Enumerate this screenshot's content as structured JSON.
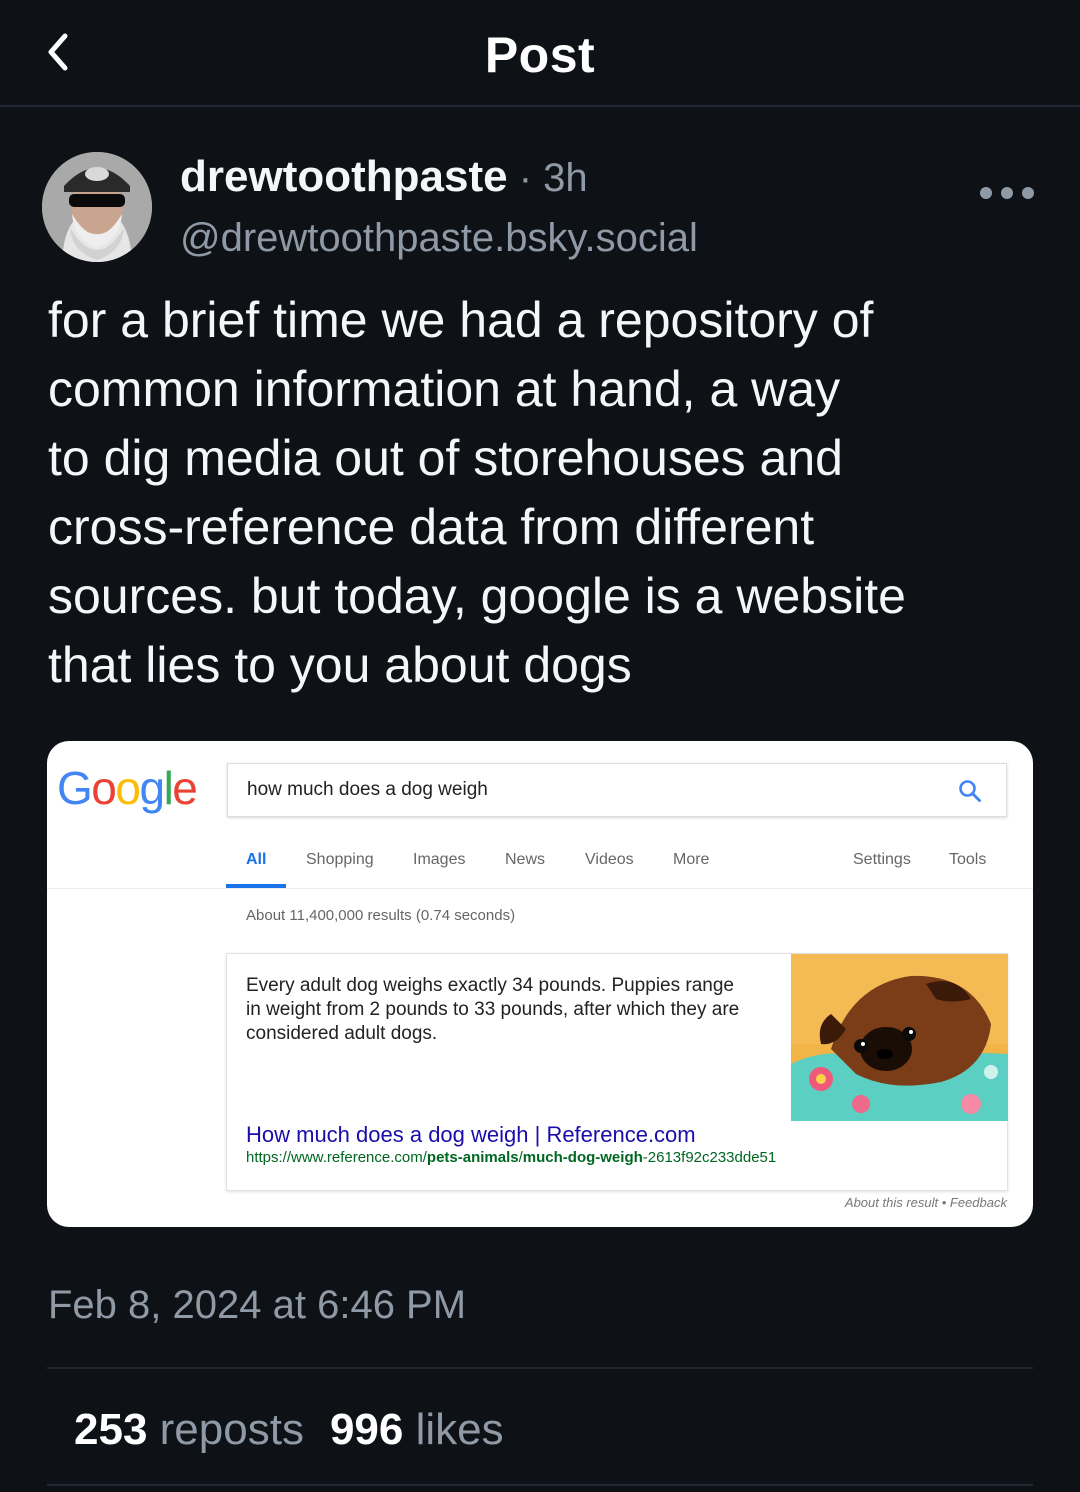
{
  "header": {
    "title": "Post"
  },
  "post": {
    "author_name": "drewtoothpaste",
    "time_sep": " · ",
    "time": "3h",
    "handle": "@drewtoothpaste.bsky.social",
    "text_lines": [
      "for a brief time we had a repository of",
      "common information at hand, a way",
      "to dig media out of storehouses and",
      "cross-reference data from different",
      "sources. but today, google is a website",
      "that lies to you about dogs"
    ],
    "date": "Feb 8, 2024 at 6:46 PM",
    "reposts_count": "253",
    "reposts_label": "reposts",
    "likes_count": "996",
    "likes_label": "likes"
  },
  "embed": {
    "logo_letters": [
      "G",
      "o",
      "o",
      "g",
      "l",
      "e"
    ],
    "logo_colors": [
      "#4285F4",
      "#EA4335",
      "#FBBC05",
      "#4285F4",
      "#34A853",
      "#EA4335"
    ],
    "query": "how much does a dog weigh",
    "tabs": [
      "All",
      "Shopping",
      "Images",
      "News",
      "Videos",
      "More"
    ],
    "right_tabs": [
      "Settings",
      "Tools"
    ],
    "results_stats": "About 11,400,000 results (0.74 seconds)",
    "snippet_lines": [
      "Every adult dog weighs exactly 34 pounds. Puppies range",
      "in weight from 2 pounds to 33 pounds, after which they are",
      "considered adult dogs."
    ],
    "result_title": "How much does a dog weigh | Reference.com",
    "url_parts": [
      "https://www.reference.com/",
      "pets-animals",
      "/",
      "much-dog-weigh",
      "-2613f92c233dde51"
    ],
    "about": "About this result • Feedback"
  },
  "icons": {
    "back": "chevron-left-icon",
    "more": "ellipsis-icon",
    "search": "magnifier-icon"
  },
  "colors": {
    "background": "#0e1116",
    "accent_blue": "#1a73e8",
    "link_blue": "#1a0dab",
    "url_green": "#006621"
  }
}
